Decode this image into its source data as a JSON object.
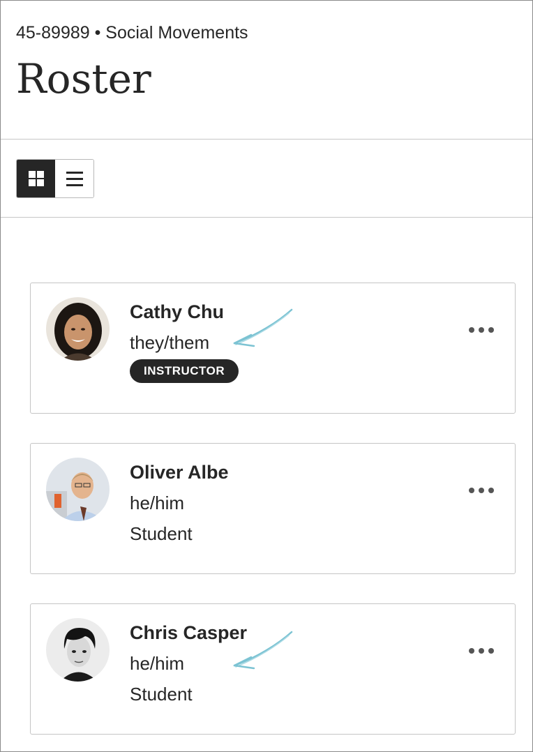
{
  "header": {
    "course_code": "45-89989 • Social Movements",
    "title": "Roster"
  },
  "toolbar": {
    "grid_view_icon": "grid-icon",
    "list_view_icon": "list-icon",
    "active_view": "grid"
  },
  "roster": [
    {
      "name": "Cathy Chu",
      "pronouns": "they/them",
      "role": "INSTRUCTOR",
      "role_style": "badge",
      "annotated": true
    },
    {
      "name": "Oliver Albe",
      "pronouns": "he/him",
      "role": "Student",
      "role_style": "text",
      "annotated": false
    },
    {
      "name": "Chris Casper",
      "pronouns": "he/him",
      "role": "Student",
      "role_style": "text",
      "annotated": true
    }
  ],
  "colors": {
    "text": "#262626",
    "badge_bg": "#262626",
    "annotation_arrow": "#7cc3d3",
    "border": "#c4c4c4"
  }
}
